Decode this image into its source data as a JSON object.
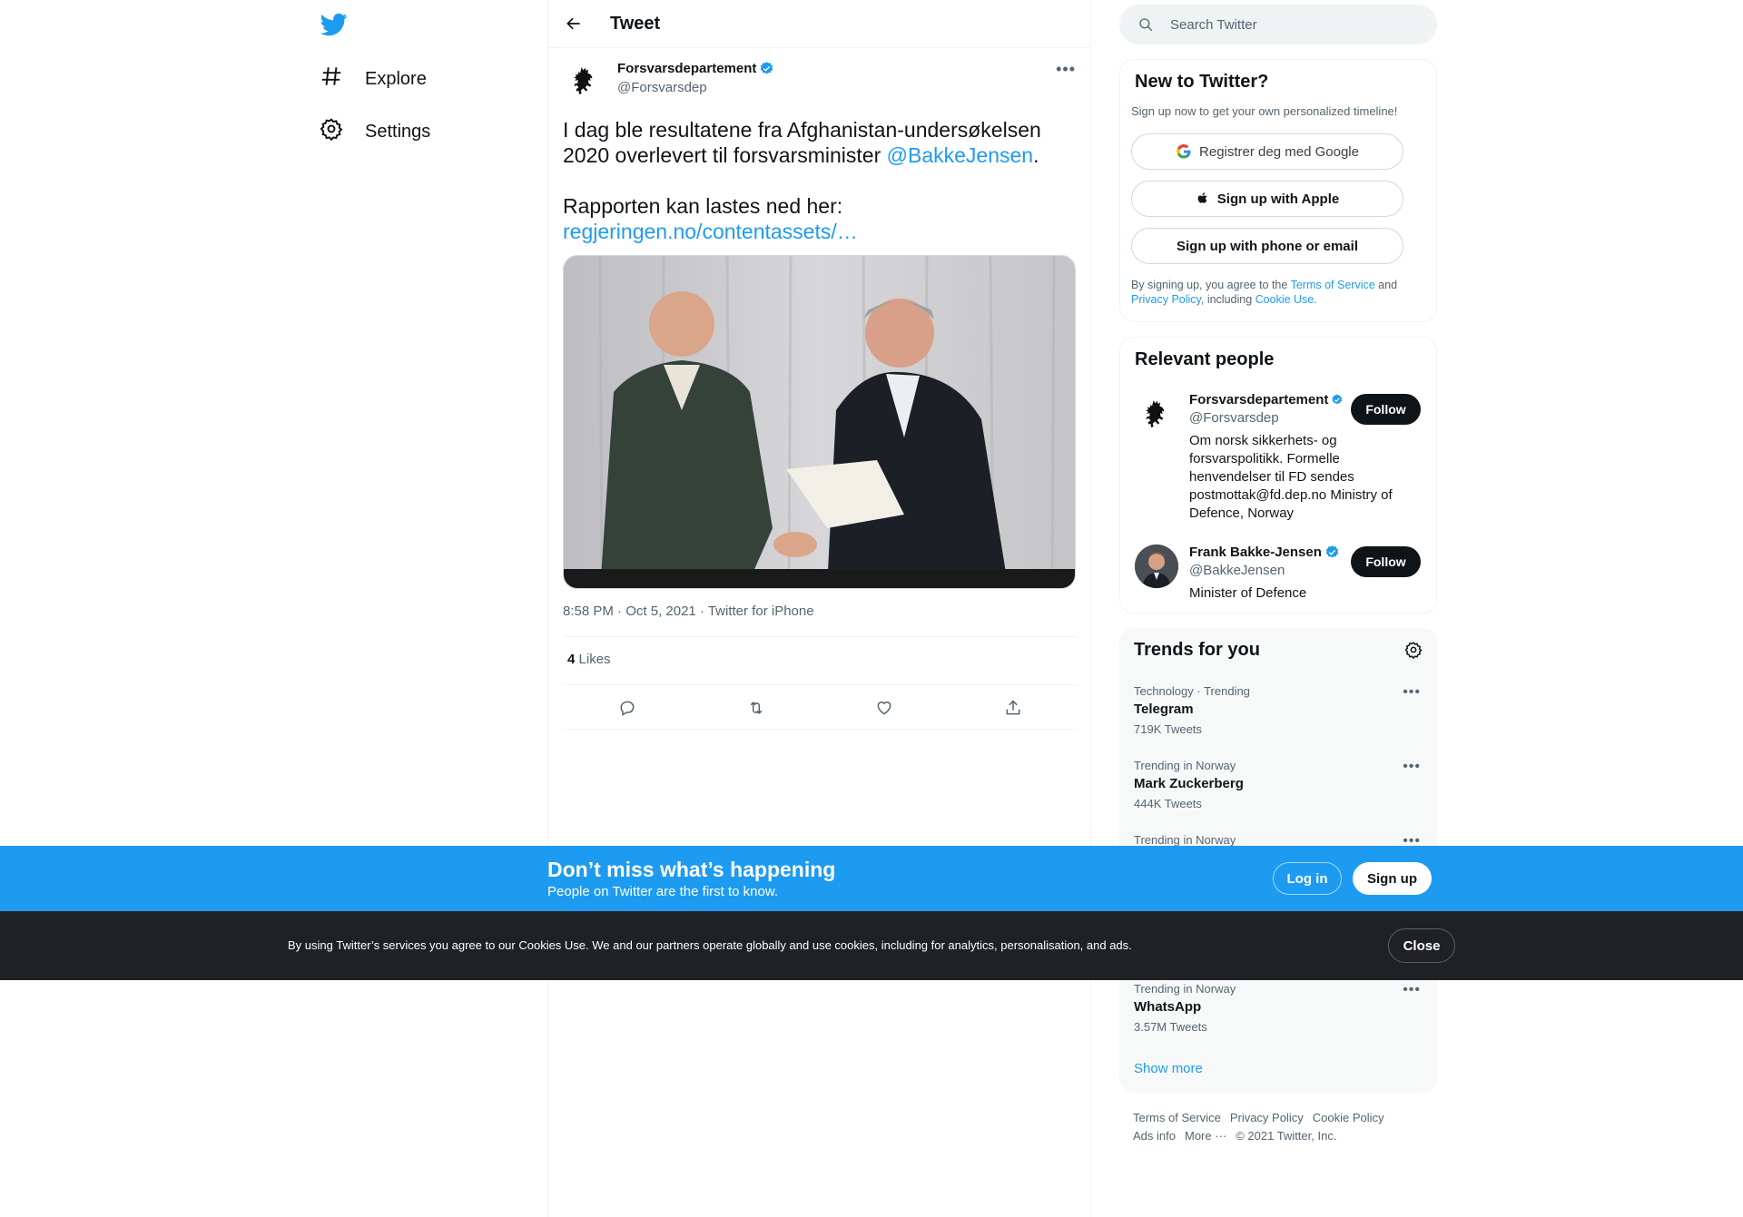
{
  "nav": {
    "items": [
      {
        "label": "Explore"
      },
      {
        "label": "Settings"
      }
    ]
  },
  "header": {
    "title": "Tweet"
  },
  "tweet": {
    "author_name": "Forsvarsdepartement",
    "author_handle": "@Forsvarsdep",
    "text_line1": "I dag ble resultatene fra Afghanistan-undersøkelsen 2020 overlevert til forsvarsminister ",
    "mention": "@BakkeJensen",
    "text_after_mention": ".",
    "text_line2": "Rapporten kan lastes ned her:",
    "link": "regjeringen.no/contentassets/…",
    "time": "8:58 PM",
    "date": "Oct 5, 2021",
    "source": "Twitter for iPhone",
    "likes_count": "4",
    "likes_label": "Likes"
  },
  "search": {
    "placeholder": "Search Twitter"
  },
  "new_to_twitter": {
    "title": "New to Twitter?",
    "subtitle": "Sign up now to get your own personalized timeline!",
    "google_label": "Registrer deg med Google",
    "apple_label": "Sign up with Apple",
    "phone_label": "Sign up with phone or email",
    "legal_prefix": "By signing up, you agree to the ",
    "tos": "Terms of Service",
    "and": " and ",
    "privacy": "Privacy Policy",
    "including": ", including ",
    "cookie": "Cookie Use."
  },
  "relevant_people": {
    "title": "Relevant people",
    "people": [
      {
        "name": "Forsvarsdepartement",
        "handle": "@Forsvarsdep",
        "bio": "Om norsk sikkerhets- og forsvarspolitikk. Formelle henvendelser til FD sendes postmottak@fd.dep.no Ministry of Defence, Norway",
        "follow_label": "Follow"
      },
      {
        "name": "Frank Bakke-Jensen",
        "handle": "@BakkeJensen",
        "bio": "Minister of Defence",
        "follow_label": "Follow"
      }
    ]
  },
  "trends": {
    "title": "Trends for you",
    "items": [
      {
        "context": "Technology · Trending",
        "name": "Telegram",
        "count": "719K Tweets"
      },
      {
        "context": "Trending in Norway",
        "name": "Mark Zuckerberg",
        "count": "444K Tweets"
      },
      {
        "context": "Trending in Norway",
        "name": "",
        "count": ""
      },
      {
        "context": "Trending in Norway",
        "name": "WhatsApp",
        "count": "3.57M Tweets"
      }
    ],
    "show_more": "Show more"
  },
  "footer": {
    "tos": "Terms of Service",
    "privacy": "Privacy Policy",
    "cookie": "Cookie Policy",
    "ads": "Ads info",
    "more": "More ···",
    "copyright": "© 2021 Twitter, Inc."
  },
  "bottom_bar": {
    "title": "Don’t miss what’s happening",
    "subtitle": "People on Twitter are the first to know.",
    "login": "Log in",
    "signup": "Sign up"
  },
  "cookie_bar": {
    "text": "By using Twitter’s services you agree to our Cookies Use. We and our partners operate globally and use cookies, including for analytics, personalisation, and ads.",
    "close": "Close"
  },
  "colors": {
    "accent": "#1d9bf0",
    "text": "#0f1419",
    "secondary": "#536471",
    "cookie_bg": "#1f2125"
  }
}
